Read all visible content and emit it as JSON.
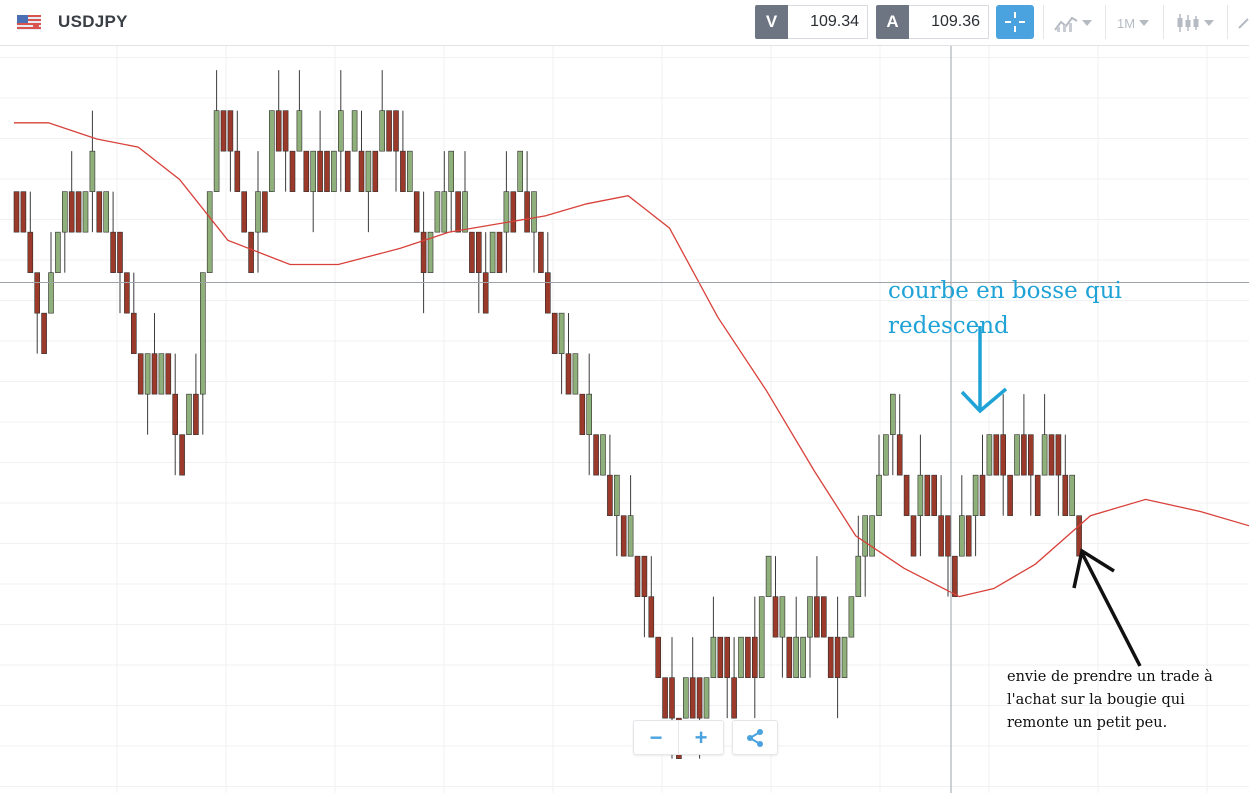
{
  "header": {
    "symbol": "USDJPY",
    "bid_label": "V",
    "bid_price": "109.34",
    "ask_label": "A",
    "ask_price": "109.36",
    "timeframe": "1M",
    "icons": [
      "us-flag-icon",
      "crosshair-icon",
      "chart-style-icon",
      "timeframe-icon",
      "candlestick-type-icon",
      "draw-tool-icon"
    ]
  },
  "controls": {
    "zoom_out": "−",
    "zoom_in": "+",
    "share_icon": "share-icon"
  },
  "annotations": {
    "blue_line1": "courbe en bosse qui",
    "blue_line2": "redescend",
    "black_line1": "envie de prendre un trade à",
    "black_line2": "l'achat sur la bougie qui",
    "black_line3": "remonte un petit peu."
  },
  "colors": {
    "bull": "#8fb07a",
    "bear": "#9b3a2a",
    "ma": "#d8413a",
    "accent": "#4aa3df",
    "annotation_blue": "#1fa3d6"
  },
  "chart_data": {
    "type": "candlestick",
    "symbol": "USDJPY",
    "timeframe": "1M",
    "x_axis": "bar index (no labels shown)",
    "y_axis": "price level (no tick labels shown; values in grid steps)",
    "crosshair_bar": 137,
    "crosshair_level": 5.5,
    "candles": [
      {
        "o": 2.5,
        "h": 2.5,
        "c": 1.5,
        "l": 1.5
      },
      {
        "o": 1.5,
        "h": 1.5,
        "c": 2.5,
        "l": 2.5
      },
      {
        "o": 2.5,
        "h": 2.5,
        "c": 1.5,
        "l": 1.5
      },
      {
        "o": 2.5,
        "h": 2.5,
        "c": 1.5,
        "l": 1.5
      },
      {
        "o": 1.5,
        "h": 1.5,
        "c": 2.5,
        "l": 2.5
      },
      {
        "o": 1.5,
        "h": 1.5,
        "c": 1.5,
        "l": 1.5
      },
      {
        "o": 1.5,
        "h": 1.5,
        "c": 2.5,
        "l": 2.5
      },
      {
        "o": 2.5,
        "h": 2.5,
        "c": 3.5,
        "l": 3.5
      },
      {
        "o": 3.5,
        "h": 3.5,
        "c": 2.5,
        "l": 2.5
      }
    ],
    "candle_note": "Full OHLC series is generated by the page script; values are read in grid steps from the top of the plot",
    "moving_average": {
      "label": "",
      "points": [
        [
          0,
          1.6
        ],
        [
          5,
          1.6
        ],
        [
          12,
          2.0
        ],
        [
          18,
          2.2
        ],
        [
          24,
          3.0
        ],
        [
          31,
          4.5
        ],
        [
          40,
          5.1
        ],
        [
          47,
          5.1
        ],
        [
          56,
          4.7
        ],
        [
          63,
          4.3
        ],
        [
          70,
          4.1
        ],
        [
          77,
          3.9
        ],
        [
          83,
          3.6
        ],
        [
          89,
          3.4
        ],
        [
          95,
          4.2
        ],
        [
          102,
          6.4
        ],
        [
          109,
          8.2
        ],
        [
          116,
          10.2
        ],
        [
          122,
          11.8
        ],
        [
          129,
          12.6
        ],
        [
          137,
          13.3
        ],
        [
          142,
          13.1
        ],
        [
          148,
          12.5
        ],
        [
          156,
          11.3
        ],
        [
          164,
          10.9
        ],
        [
          172,
          11.2
        ],
        [
          180,
          11.6
        ]
      ]
    }
  }
}
